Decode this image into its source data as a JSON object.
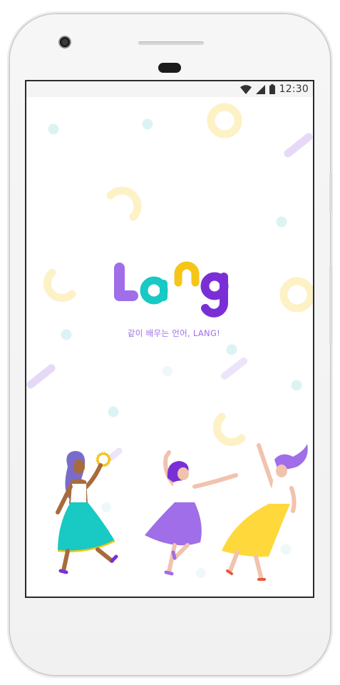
{
  "status_bar": {
    "time": "12:30",
    "icons": [
      "wifi-icon",
      "cellular-signal-icon",
      "battery-icon"
    ]
  },
  "splash": {
    "logo_letters": [
      "L",
      "a",
      "n",
      "g"
    ],
    "tagline": "같이 배우는 언어, LANG!"
  },
  "colors": {
    "logo_l": "#a06ee8",
    "logo_a": "#18c9c4",
    "logo_n": "#f5c518",
    "logo_g": "#7a2fd6",
    "tagline": "#a06ee8",
    "deco_yellow": "#fdf1c6",
    "deco_purple": "#e6d9f8",
    "deco_cyan": "#dcf3f4"
  }
}
